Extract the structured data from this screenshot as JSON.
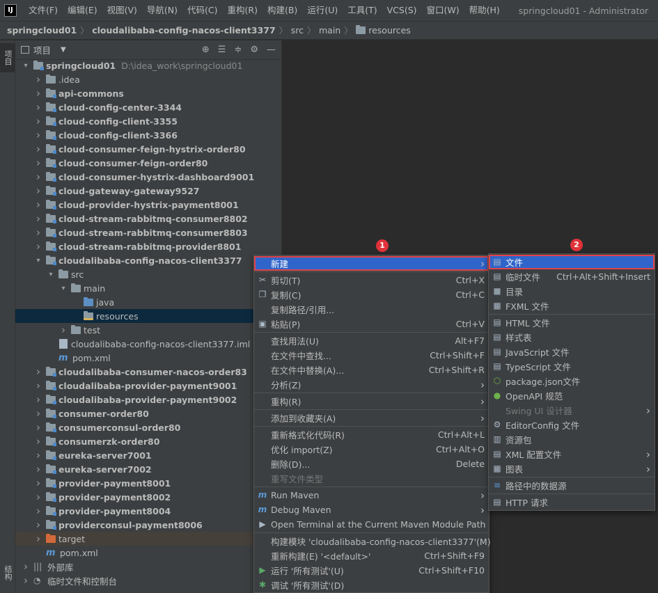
{
  "app": {
    "logo": "IJ",
    "window_title": "springcloud01 - Administrator"
  },
  "menubar": [
    "文件(F)",
    "编辑(E)",
    "视图(V)",
    "导航(N)",
    "代码(C)",
    "重构(R)",
    "构建(B)",
    "运行(U)",
    "工具(T)",
    "VCS(S)",
    "窗口(W)",
    "帮助(H)"
  ],
  "breadcrumb": [
    "springcloud01",
    "cloudalibaba-config-nacos-client3377",
    "src",
    "main",
    "resources"
  ],
  "toolstrip": {
    "top_tab": "项目",
    "bottom_tab": "结构"
  },
  "panel": {
    "title": "项目"
  },
  "tree": [
    {
      "label": "springcloud01",
      "hint": "D:\\idea_work\\springcloud01",
      "depth": 0,
      "arrow": "open",
      "icon": "folder-module",
      "bold": true
    },
    {
      "label": ".idea",
      "depth": 1,
      "arrow": "closed",
      "icon": "folder",
      "bold": false
    },
    {
      "label": "api-commons",
      "depth": 1,
      "arrow": "closed",
      "icon": "folder-module",
      "bold": true
    },
    {
      "label": "cloud-config-center-3344",
      "depth": 1,
      "arrow": "closed",
      "icon": "folder-module",
      "bold": true
    },
    {
      "label": "cloud-config-client-3355",
      "depth": 1,
      "arrow": "closed",
      "icon": "folder-module",
      "bold": true
    },
    {
      "label": "cloud-config-client-3366",
      "depth": 1,
      "arrow": "closed",
      "icon": "folder-module",
      "bold": true
    },
    {
      "label": "cloud-consumer-feign-hystrix-order80",
      "depth": 1,
      "arrow": "closed",
      "icon": "folder-module",
      "bold": true
    },
    {
      "label": "cloud-consumer-feign-order80",
      "depth": 1,
      "arrow": "closed",
      "icon": "folder-module",
      "bold": true
    },
    {
      "label": "cloud-consumer-hystrix-dashboard9001",
      "depth": 1,
      "arrow": "closed",
      "icon": "folder-module",
      "bold": true
    },
    {
      "label": "cloud-gateway-gateway9527",
      "depth": 1,
      "arrow": "closed",
      "icon": "folder-module",
      "bold": true
    },
    {
      "label": "cloud-provider-hystrix-payment8001",
      "depth": 1,
      "arrow": "closed",
      "icon": "folder-module",
      "bold": true
    },
    {
      "label": "cloud-stream-rabbitmq-consumer8802",
      "depth": 1,
      "arrow": "closed",
      "icon": "folder-module",
      "bold": true
    },
    {
      "label": "cloud-stream-rabbitmq-consumer8803",
      "depth": 1,
      "arrow": "closed",
      "icon": "folder-module",
      "bold": true
    },
    {
      "label": "cloud-stream-rabbitmq-provider8801",
      "depth": 1,
      "arrow": "closed",
      "icon": "folder-module",
      "bold": true
    },
    {
      "label": "cloudalibaba-config-nacos-client3377",
      "depth": 1,
      "arrow": "open",
      "icon": "folder-module",
      "bold": true
    },
    {
      "label": "src",
      "depth": 2,
      "arrow": "open",
      "icon": "folder",
      "bold": false
    },
    {
      "label": "main",
      "depth": 3,
      "arrow": "open",
      "icon": "folder",
      "bold": false
    },
    {
      "label": "java",
      "depth": 4,
      "arrow": "none",
      "icon": "folder-blue",
      "bold": false
    },
    {
      "label": "resources",
      "depth": 4,
      "arrow": "none",
      "icon": "folder-res",
      "bold": false,
      "selected": true
    },
    {
      "label": "test",
      "depth": 3,
      "arrow": "closed",
      "icon": "folder",
      "bold": false
    },
    {
      "label": "cloudalibaba-config-nacos-client3377.iml",
      "depth": 2,
      "arrow": "none",
      "icon": "file",
      "bold": false
    },
    {
      "label": "pom.xml",
      "depth": 2,
      "arrow": "none",
      "icon": "maven",
      "bold": false
    },
    {
      "label": "cloudalibaba-consumer-nacos-order83",
      "depth": 1,
      "arrow": "closed",
      "icon": "folder-module",
      "bold": true
    },
    {
      "label": "cloudalibaba-provider-payment9001",
      "depth": 1,
      "arrow": "closed",
      "icon": "folder-module",
      "bold": true
    },
    {
      "label": "cloudalibaba-provider-payment9002",
      "depth": 1,
      "arrow": "closed",
      "icon": "folder-module",
      "bold": true
    },
    {
      "label": "consumer-order80",
      "depth": 1,
      "arrow": "closed",
      "icon": "folder-module",
      "bold": true
    },
    {
      "label": "consumerconsul-order80",
      "depth": 1,
      "arrow": "closed",
      "icon": "folder-module",
      "bold": true
    },
    {
      "label": "consumerzk-order80",
      "depth": 1,
      "arrow": "closed",
      "icon": "folder-module",
      "bold": true
    },
    {
      "label": "eureka-server7001",
      "depth": 1,
      "arrow": "closed",
      "icon": "folder-module",
      "bold": true
    },
    {
      "label": "eureka-server7002",
      "depth": 1,
      "arrow": "closed",
      "icon": "folder-module",
      "bold": true
    },
    {
      "label": "provider-payment8001",
      "depth": 1,
      "arrow": "closed",
      "icon": "folder-module",
      "bold": true
    },
    {
      "label": "provider-payment8002",
      "depth": 1,
      "arrow": "closed",
      "icon": "folder-module",
      "bold": true
    },
    {
      "label": "provider-payment8004",
      "depth": 1,
      "arrow": "closed",
      "icon": "folder-module",
      "bold": true
    },
    {
      "label": "providerconsul-payment8006",
      "depth": 1,
      "arrow": "closed",
      "icon": "folder-module",
      "bold": true
    },
    {
      "label": "target",
      "depth": 1,
      "arrow": "closed",
      "icon": "folder-orange",
      "bold": false,
      "highlight": true
    },
    {
      "label": "pom.xml",
      "depth": 1,
      "arrow": "none",
      "icon": "maven",
      "bold": false
    },
    {
      "label": "外部库",
      "depth": 0,
      "arrow": "closed",
      "icon": "library",
      "bold": false
    },
    {
      "label": "临时文件和控制台",
      "depth": 0,
      "arrow": "closed",
      "icon": "scratch",
      "bold": false
    }
  ],
  "context_menu": [
    {
      "label": "新建",
      "shortcut": "",
      "submenu": true,
      "selected": true
    },
    {
      "sep": true
    },
    {
      "label": "剪切(T)",
      "shortcut": "Ctrl+X",
      "icon": "scissors-icon",
      "glyph": "✂"
    },
    {
      "label": "复制(C)",
      "shortcut": "Ctrl+C",
      "icon": "copy-icon",
      "glyph": "❐"
    },
    {
      "label": "复制路径/引用...",
      "shortcut": ""
    },
    {
      "label": "粘贴(P)",
      "shortcut": "Ctrl+V",
      "icon": "paste-icon",
      "glyph": "▣"
    },
    {
      "sep": true
    },
    {
      "label": "查找用法(U)",
      "shortcut": "Alt+F7"
    },
    {
      "label": "在文件中查找...",
      "shortcut": "Ctrl+Shift+F"
    },
    {
      "label": "在文件中替换(A)...",
      "shortcut": "Ctrl+Shift+R"
    },
    {
      "label": "分析(Z)",
      "shortcut": "",
      "submenu": true
    },
    {
      "sep": true
    },
    {
      "label": "重构(R)",
      "shortcut": "",
      "submenu": true
    },
    {
      "sep": true
    },
    {
      "label": "添加到收藏夹(A)",
      "shortcut": "",
      "submenu": true
    },
    {
      "sep": true
    },
    {
      "label": "重新格式化代码(R)",
      "shortcut": "Ctrl+Alt+L"
    },
    {
      "label": "优化 import(Z)",
      "shortcut": "Ctrl+Alt+O"
    },
    {
      "label": "删除(D)...",
      "shortcut": "Delete"
    },
    {
      "label": "重写文件类型",
      "shortcut": "",
      "disabled": true
    },
    {
      "sep": true
    },
    {
      "label": "Run Maven",
      "shortcut": "",
      "submenu": true,
      "icon": "maven-run-icon",
      "glyph": "m"
    },
    {
      "label": "Debug Maven",
      "shortcut": "",
      "submenu": true,
      "icon": "maven-debug-icon",
      "glyph": "m"
    },
    {
      "label": "Open Terminal at the Current Maven Module Path",
      "shortcut": "",
      "icon": "terminal-icon",
      "glyph": "▶"
    },
    {
      "sep": true
    },
    {
      "label": "构建模块 'cloudalibaba-config-nacos-client3377'(M)",
      "shortcut": ""
    },
    {
      "label": "重新构建(E) '<default>'",
      "shortcut": "Ctrl+Shift+F9"
    },
    {
      "label": "运行 '所有测试'(U)",
      "shortcut": "Ctrl+Shift+F10",
      "icon": "run-icon",
      "glyph": "▶"
    },
    {
      "label": "调试 '所有测试'(D)",
      "shortcut": "",
      "icon": "debug-icon",
      "glyph": "✱"
    }
  ],
  "submenu": [
    {
      "label": "文件",
      "shortcut": "",
      "selected": true,
      "icon": "file-icon",
      "glyph": "▤"
    },
    {
      "label": "临时文件",
      "shortcut": "Ctrl+Alt+Shift+Insert",
      "icon": "scratch-file-icon",
      "glyph": "▤"
    },
    {
      "label": "目录",
      "shortcut": "",
      "icon": "directory-icon",
      "glyph": "■"
    },
    {
      "label": "FXML 文件",
      "shortcut": "",
      "icon": "fxml-icon",
      "glyph": "▦"
    },
    {
      "sep": true
    },
    {
      "label": "HTML 文件",
      "shortcut": "",
      "icon": "html-icon",
      "glyph": "▤"
    },
    {
      "label": "样式表",
      "shortcut": "",
      "icon": "css-icon",
      "glyph": "▤"
    },
    {
      "label": "JavaScript 文件",
      "shortcut": "",
      "icon": "javascript-icon",
      "glyph": "▤"
    },
    {
      "label": "TypeScript 文件",
      "shortcut": "",
      "icon": "typescript-icon",
      "glyph": "▤"
    },
    {
      "label": "package.json文件",
      "shortcut": "",
      "icon": "package-json-icon",
      "glyph": "⬡"
    },
    {
      "label": "OpenAPI 规范",
      "shortcut": "",
      "icon": "openapi-icon",
      "glyph": "●"
    },
    {
      "label": "Swing UI 设计器",
      "shortcut": "",
      "disabled": true,
      "submenu": true
    },
    {
      "label": "EditorConfig 文件",
      "shortcut": "",
      "icon": "editorconfig-icon",
      "glyph": "⚙"
    },
    {
      "label": "资源包",
      "shortcut": "",
      "icon": "resource-bundle-icon",
      "glyph": "▥"
    },
    {
      "label": "XML 配置文件",
      "shortcut": "",
      "submenu": true,
      "icon": "xml-icon",
      "glyph": "▤"
    },
    {
      "label": "图表",
      "shortcut": "",
      "submenu": true,
      "icon": "diagram-icon",
      "glyph": "▦"
    },
    {
      "sep": true
    },
    {
      "label": "路径中的数据源",
      "shortcut": "",
      "icon": "datasource-icon",
      "glyph": "≡"
    },
    {
      "sep": true
    },
    {
      "label": "HTTP 请求",
      "shortcut": "",
      "icon": "http-request-icon",
      "glyph": "▤"
    }
  ],
  "badges": [
    "1",
    "2"
  ],
  "colors": {
    "selection": "#2f65ca",
    "highlight_border": "#e0434a",
    "badge": "#e0323a",
    "maven_blue": "#5a9ad8"
  }
}
